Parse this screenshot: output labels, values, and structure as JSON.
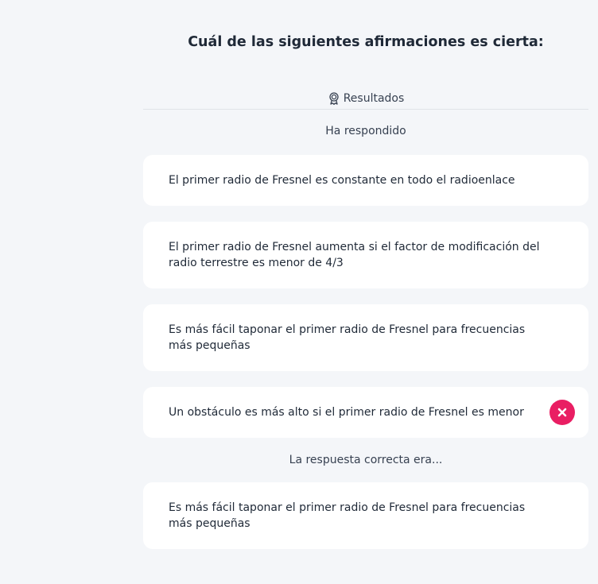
{
  "question": {
    "title": "Cuál de las siguientes afirmaciones es cierta:"
  },
  "results": {
    "icon": "award-ribbon-icon",
    "label": "Resultados"
  },
  "answered_label": "Ha respondido",
  "answers": [
    {
      "text": "El primer radio de Fresnel es constante en todo el radioenlace",
      "selected": false
    },
    {
      "text": "El primer radio de Fresnel aumenta si el factor de modificación del radio terrestre es menor de 4/3",
      "selected": false
    },
    {
      "text": "Es más fácil taponar el primer radio de Fresnel para frecuencias más pequeñas",
      "selected": false
    },
    {
      "text": "Un obstáculo es más alto si el primer radio de Fresnel es menor",
      "selected": true,
      "status": "incorrect",
      "status_icon": "close-icon"
    }
  ],
  "correct_label": "La respuesta correcta era...",
  "correct_answer": {
    "text": "Es más fácil taponar el primer radio de Fresnel para frecuencias más pequeñas"
  },
  "colors": {
    "background": "#f4f6f9",
    "card": "#ffffff",
    "incorrect": "#e91e63"
  }
}
